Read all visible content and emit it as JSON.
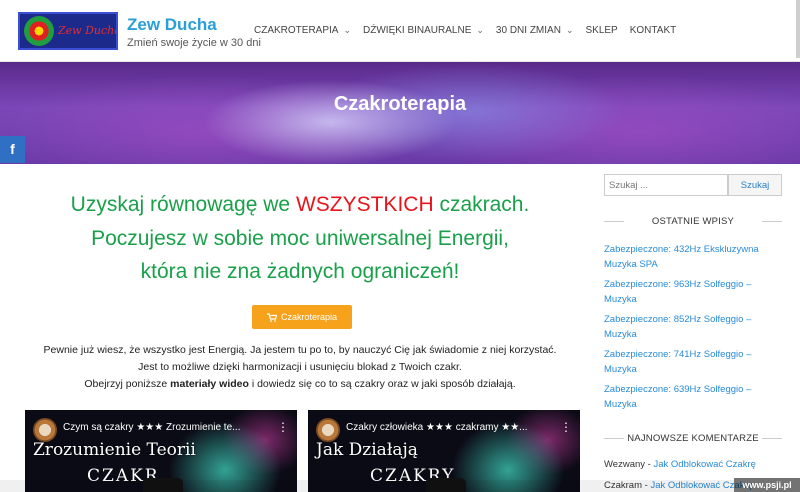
{
  "site": {
    "title": "Zew Ducha",
    "tagline": "Zmień swoje życie w 30 dni",
    "logo_text": "Zew Ducha"
  },
  "nav": {
    "items": [
      {
        "label": "CZAKROTERAPIA",
        "has_dropdown": true
      },
      {
        "label": "DŹWIĘKI BINAURALNE",
        "has_dropdown": true
      },
      {
        "label": "30 DNI ZMIAN",
        "has_dropdown": true
      },
      {
        "label": "SKLEP",
        "has_dropdown": false
      },
      {
        "label": "KONTAKT",
        "has_dropdown": false
      }
    ]
  },
  "hero": {
    "title": "Czakroterapia",
    "facebook_icon": "f"
  },
  "main": {
    "headline_1_pre": "Uzyskaj równowagę we ",
    "headline_1_emph": "WSZYSTKICH",
    "headline_1_post": " czakrach.",
    "headline_2": "Poczujesz w sobie moc uniwersalnej Energii,",
    "headline_3": "która nie zna żadnych ograniczeń!",
    "cta_label": "Czakroterapia",
    "cta_icon": "cart-icon",
    "body_1": "Pewnie już wiesz, że wszystko jest Energią. Ja jestem tu po to, by nauczyć Cię jak świadomie z niej korzystać.",
    "body_2": "Jest to możliwe dzięki harmonizacji i usunięciu blokad z Twoich czakr.",
    "body_3_pre": "Obejrzyj poniższe ",
    "body_3_bold": "materiały wideo",
    "body_3_post": " i dowiedz się co to są czakry oraz w jaki sposób działają.",
    "videos": [
      {
        "title": "Czym są czakry ★★★ Zrozumienie te...",
        "overlay_1": "Zrozumienie Teorii",
        "overlay_2": "CZAKR"
      },
      {
        "title": "Czakry człowieka ★★★ czakramy ★★...",
        "overlay_1": "Jak Działają",
        "overlay_2": "CZAKRY"
      }
    ]
  },
  "sidebar": {
    "search_placeholder": "Szukaj ...",
    "search_button": "Szukaj",
    "recent_posts_title": "OSTATNIE WPISY",
    "recent_posts": [
      {
        "line1": "Zabezpieczone: 432Hz Ekskluzywna",
        "line2": "Muzyka SPA"
      },
      {
        "line1": "Zabezpieczone: 963Hz Solfeggio –",
        "line2": "Muzyka"
      },
      {
        "line1": "Zabezpieczone: 852Hz Solfeggio –",
        "line2": "Muzyka"
      },
      {
        "line1": "Zabezpieczone: 741Hz Solfeggio –",
        "line2": "Muzyka"
      },
      {
        "line1": "Zabezpieczone: 639Hz Solfeggio –",
        "line2": "Muzyka"
      }
    ],
    "comments_title": "NAJNOWSZE KOMENTARZE",
    "comments": [
      {
        "author": "Wezwany",
        "sep": " - ",
        "link": "Jak Odblokować Czakrę"
      },
      {
        "author": "Czakram",
        "sep": " - ",
        "link": "Jak Odblokować Czakrę"
      }
    ]
  },
  "watermark": "www.psji.pl",
  "colors": {
    "accent_blue": "#2a9fd6",
    "headline_green": "#1aa04a",
    "emphasis_red": "#e8141c",
    "cta_orange": "#f7a21b",
    "hero_purple": "#6a3aa6",
    "facebook_blue": "#2f6fc4"
  }
}
